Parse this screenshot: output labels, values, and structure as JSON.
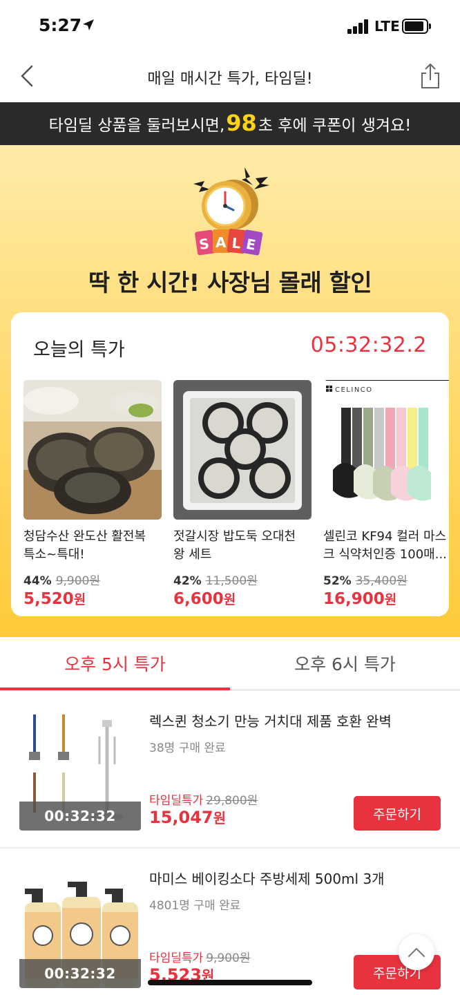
{
  "status_bar": {
    "time": "5:27",
    "network": "LTE"
  },
  "nav": {
    "title": "매일 매시간 특가, 타임딜!"
  },
  "coupon_banner": {
    "prefix": "타임딜 상품을 둘러보시면,",
    "seconds": "98",
    "suffix": "초 후에 쿠폰이 생겨요!"
  },
  "hero": {
    "icon_label": "SALE",
    "headline": "딱 한 시간! 사장님 몰래 할인",
    "card_title": "오늘의 특가",
    "countdown": "05:32:32.2",
    "products": [
      {
        "name": "청담수산 완도산 활전복 특소~특대!",
        "discount": "44%",
        "original_price": "9,900원",
        "price": "5,520",
        "won": "원",
        "image": "abalone"
      },
      {
        "name": "젓갈시장 밥도둑 오대천왕 세트",
        "discount": "42%",
        "original_price": "11,500원",
        "price": "6,600",
        "won": "원",
        "image": "jeotgal-set"
      },
      {
        "name": "셀린코 KF94 컬러 마스크 식약처인증 100매...",
        "discount": "52%",
        "original_price": "35,400원",
        "price": "16,900",
        "won": "원",
        "image": "kf94-masks",
        "brand": "CELINCO"
      }
    ]
  },
  "tabs": [
    {
      "label": "오후 5시 특가",
      "active": true
    },
    {
      "label": "오후 6시 특가",
      "active": false
    }
  ],
  "list": [
    {
      "title": "렉스퀸 청소기 만능 거치대 제품 호환 완벽",
      "buyers": "38명 구매 완료",
      "promo_label": "타임딜특가",
      "original_price": "29,800원",
      "price": "15,047",
      "won": "원",
      "countdown": "00:32:32",
      "button": "주문하기",
      "image": "vacuum-stand"
    },
    {
      "title": "마미스 베이킹소다 주방세제 500ml 3개",
      "buyers": "4801명 구매 완료",
      "promo_label": "타임딜특가",
      "original_price": "9,900원",
      "price": "5,523",
      "won": "원",
      "countdown": "00:32:32",
      "button": "주문하기",
      "image": "detergent-bottles"
    }
  ],
  "colors": {
    "accent": "#e8333f",
    "banner_bg": "#2a2a2a",
    "highlight": "#ffd21a",
    "hero_top": "#ffeaa8",
    "hero_bottom": "#ffca3a"
  }
}
